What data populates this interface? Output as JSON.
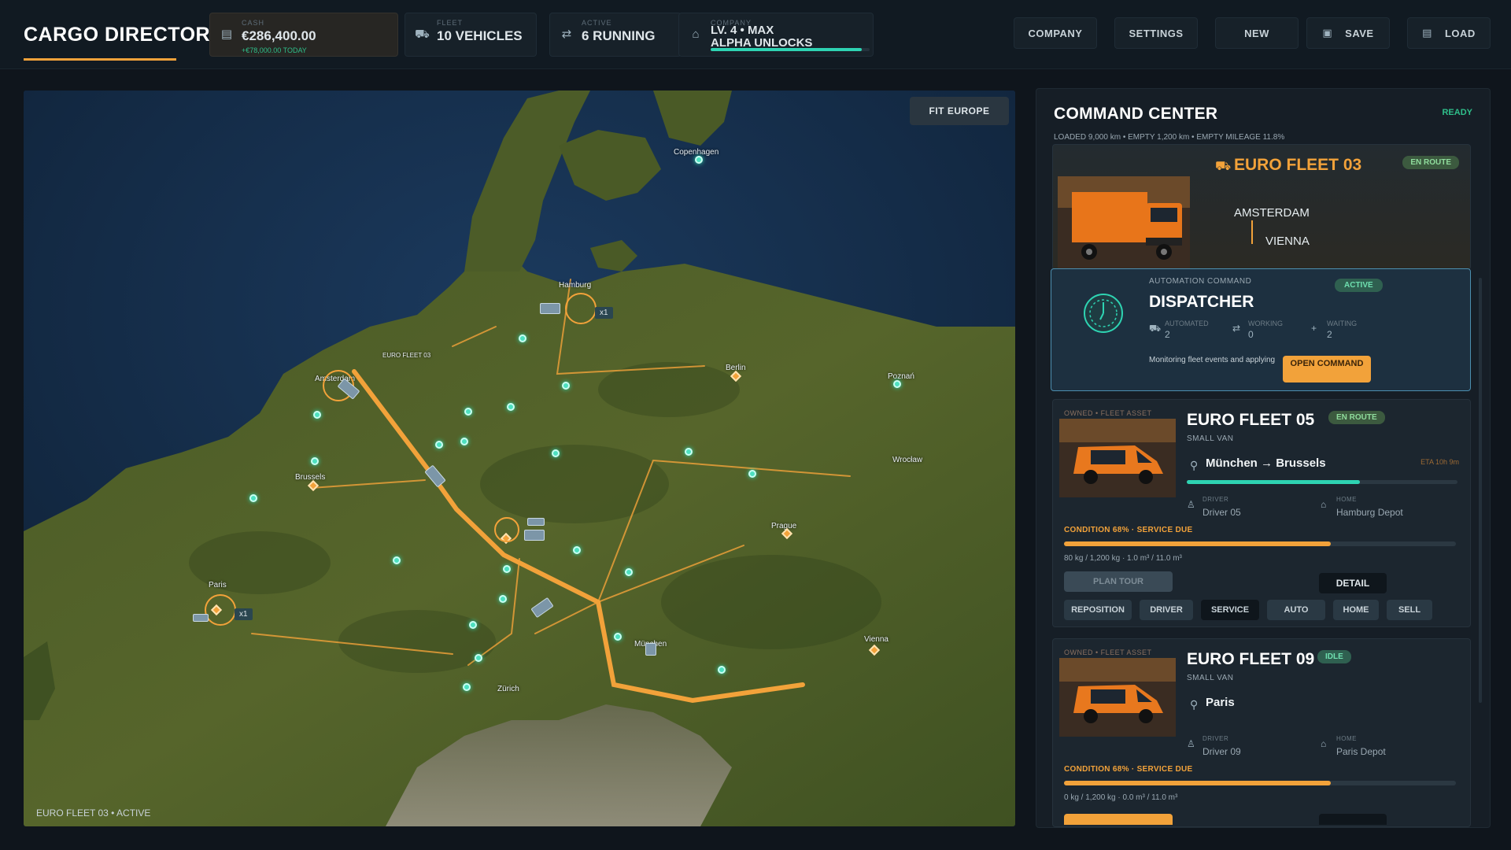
{
  "header": {
    "title": "CARGO DIRECTORATE",
    "stats": {
      "cash": {
        "label": "CASH",
        "value": "€286,400.00",
        "sub": "+€78,000.00 TODAY"
      },
      "fleet": {
        "label": "FLEET",
        "value": "10 VEHICLES"
      },
      "active": {
        "label": "ACTIVE",
        "value": "6 RUNNING"
      },
      "company": {
        "label": "COMPANY",
        "line1": "LV. 4 • MAX",
        "line2": "ALPHA UNLOCKS",
        "progress": 0.95
      }
    },
    "buttons": {
      "company": "COMPANY",
      "settings": "SETTINGS",
      "new": "NEW",
      "save": "SAVE",
      "load": "LOAD"
    }
  },
  "map": {
    "fit_button": "FIT EUROPE",
    "footer": "EURO FLEET 03 • ACTIVE",
    "cities": {
      "copenhagen": "Copenhagen",
      "hamburg": "Hamburg",
      "berlin": "Berlin",
      "poznan": "Poznań",
      "amsterdam": "Amsterdam",
      "brussels": "Brussels",
      "wroclaw": "Wrocław",
      "prague": "Prague",
      "paris": "Paris",
      "munchen": "München",
      "zurich": "Zürich",
      "vienna": "Vienna",
      "fleet_label": "EURO FLEET 03"
    },
    "cluster_counts": {
      "hamburg": "x1",
      "paris": "x1"
    },
    "icons": {
      "truck": "truck-icon",
      "depot": "depot-diamond-icon",
      "node": "waypoint-node-icon"
    }
  },
  "panel": {
    "title": "COMMAND CENTER",
    "status": "READY",
    "stats": "LOADED 9,000 km • EMPTY 1,200 km • EMPTY MILEAGE 11.8%",
    "hero": {
      "name": "EURO FLEET 03",
      "badge": "EN ROUTE",
      "from": "AMSTERDAM",
      "to": "VIENNA"
    },
    "dispatcher": {
      "kicker": "AUTOMATION COMMAND",
      "title": "DISPATCHER",
      "badge": "ACTIVE",
      "metrics": [
        {
          "label": "AUTOMATED",
          "value": "2"
        },
        {
          "label": "WORKING",
          "value": "0"
        },
        {
          "label": "WAITING",
          "value": "2"
        }
      ],
      "description": "Monitoring fleet events and applying",
      "button": "OPEN COMMAND"
    },
    "fleets": [
      {
        "kicker": "OWNED • FLEET ASSET",
        "name": "EURO FLEET 05",
        "badge": "EN ROUTE",
        "type": "SMALL VAN",
        "origin": "München",
        "arrow": "→",
        "destination": "Brussels",
        "eta": "ETA 10h 9m",
        "route_progress": 0.64,
        "driver_label": "DRIVER",
        "driver": "Driver 05",
        "home_label": "HOME",
        "home": "Hamburg Depot",
        "condition": "CONDITION  68% · SERVICE DUE",
        "condition_value": 0.68,
        "load": "80 kg / 1,200 kg   ·   1.0 m³ / 11.0 m³",
        "plan_button": "PLAN TOUR",
        "detail_button": "DETAIL",
        "actions": [
          "REPOSITION",
          "DRIVER",
          "SERVICE",
          "AUTO",
          "HOME",
          "SELL"
        ]
      },
      {
        "kicker": "OWNED • FLEET ASSET",
        "name": "EURO FLEET 09",
        "badge": "IDLE",
        "type": "SMALL VAN",
        "location": "Paris",
        "driver_label": "DRIVER",
        "driver": "Driver 09",
        "home_label": "HOME",
        "home": "Paris Depot",
        "condition": "CONDITION  68% · SERVICE DUE",
        "condition_value": 0.68,
        "load": "0 kg / 1,200 kg   ·   0.0 m³ / 11.0 m³"
      }
    ]
  },
  "colors": {
    "accent": "#f2a23a",
    "teal": "#2ed3b2",
    "panel": "#161e26",
    "background": "#0f151c"
  }
}
